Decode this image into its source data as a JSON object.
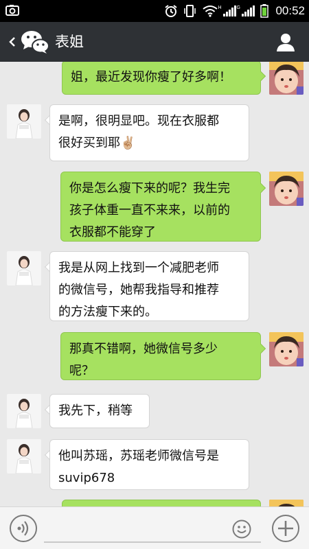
{
  "status_bar": {
    "time": "00:52",
    "network_1": "H",
    "network_2": "G",
    "icons": [
      "camera-icon",
      "alarm-icon",
      "vibrate-icon",
      "wifi-icon",
      "signal-icon",
      "battery-icon"
    ]
  },
  "header": {
    "title": "表姐",
    "icons": [
      "back-chevron-icon",
      "wechat-logo-icon",
      "profile-icon"
    ]
  },
  "messages": [
    {
      "side": "out",
      "lines": [
        "姐，最近发现你瘦了好多啊！"
      ]
    },
    {
      "side": "in",
      "lines": [
        "是啊，很明显吧。现在衣服都",
        "很好买到耶"
      ],
      "emoji": "✌🏼"
    },
    {
      "side": "out",
      "lines": [
        "你是怎么瘦下来的呢？我生完",
        "孩子体重一直不来来，以前的",
        "衣服都不能穿了"
      ]
    },
    {
      "side": "in",
      "lines": [
        "我是从网上找到一个减肥老师",
        "的微信号，她帮我指导和推荐",
        "的方法瘦下来的。"
      ]
    },
    {
      "side": "out",
      "lines": [
        "那真不错啊，她微信号多少",
        "呢？"
      ]
    },
    {
      "side": "in",
      "lines": [
        "我先下，稍等"
      ]
    },
    {
      "side": "in",
      "lines": [
        "他叫苏瑶，苏瑶老师微信号是",
        "suvip678"
      ]
    },
    {
      "side": "out",
      "lines": [
        ""
      ]
    }
  ],
  "input_bar": {
    "text_value": "",
    "icons": [
      "voice-icon",
      "emoji-icon",
      "plus-icon"
    ]
  },
  "colors": {
    "title_bar": "#2e3135",
    "chat_background": "#e9e9e9",
    "outgoing_bubble": "#a6e160",
    "incoming_bubble": "#ffffff"
  }
}
